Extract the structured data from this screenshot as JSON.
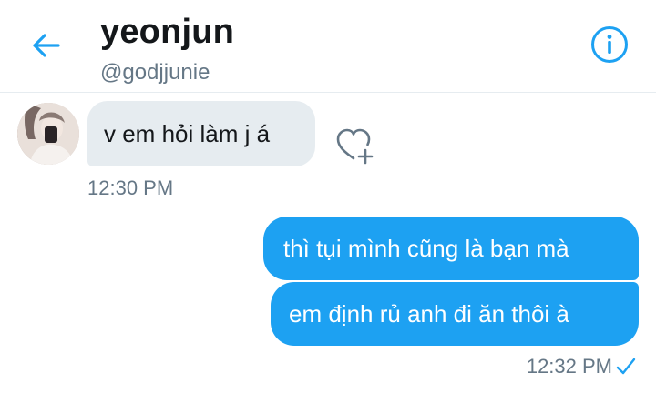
{
  "header": {
    "name": "yeonjun",
    "handle": "@godjjunie",
    "back_icon": "arrow-left-icon",
    "info_icon": "info-icon"
  },
  "messages": [
    {
      "direction": "incoming",
      "text": "v em hỏi làm j á"
    },
    {
      "direction": "outgoing",
      "text": "thì tụi mình cũng là bạn mà"
    },
    {
      "direction": "outgoing",
      "text": "em định rủ anh đi ăn thôi à"
    }
  ],
  "timestamps": {
    "incoming": "12:30 PM",
    "outgoing": "12:32 PM"
  },
  "icons": {
    "react": "heart-plus-icon",
    "read_receipt": "checkmark-icon"
  },
  "colors": {
    "accent": "#1da1f2",
    "incoming_bubble": "#e6ecf0",
    "secondary_text": "#657786",
    "primary_text": "#14171a"
  }
}
